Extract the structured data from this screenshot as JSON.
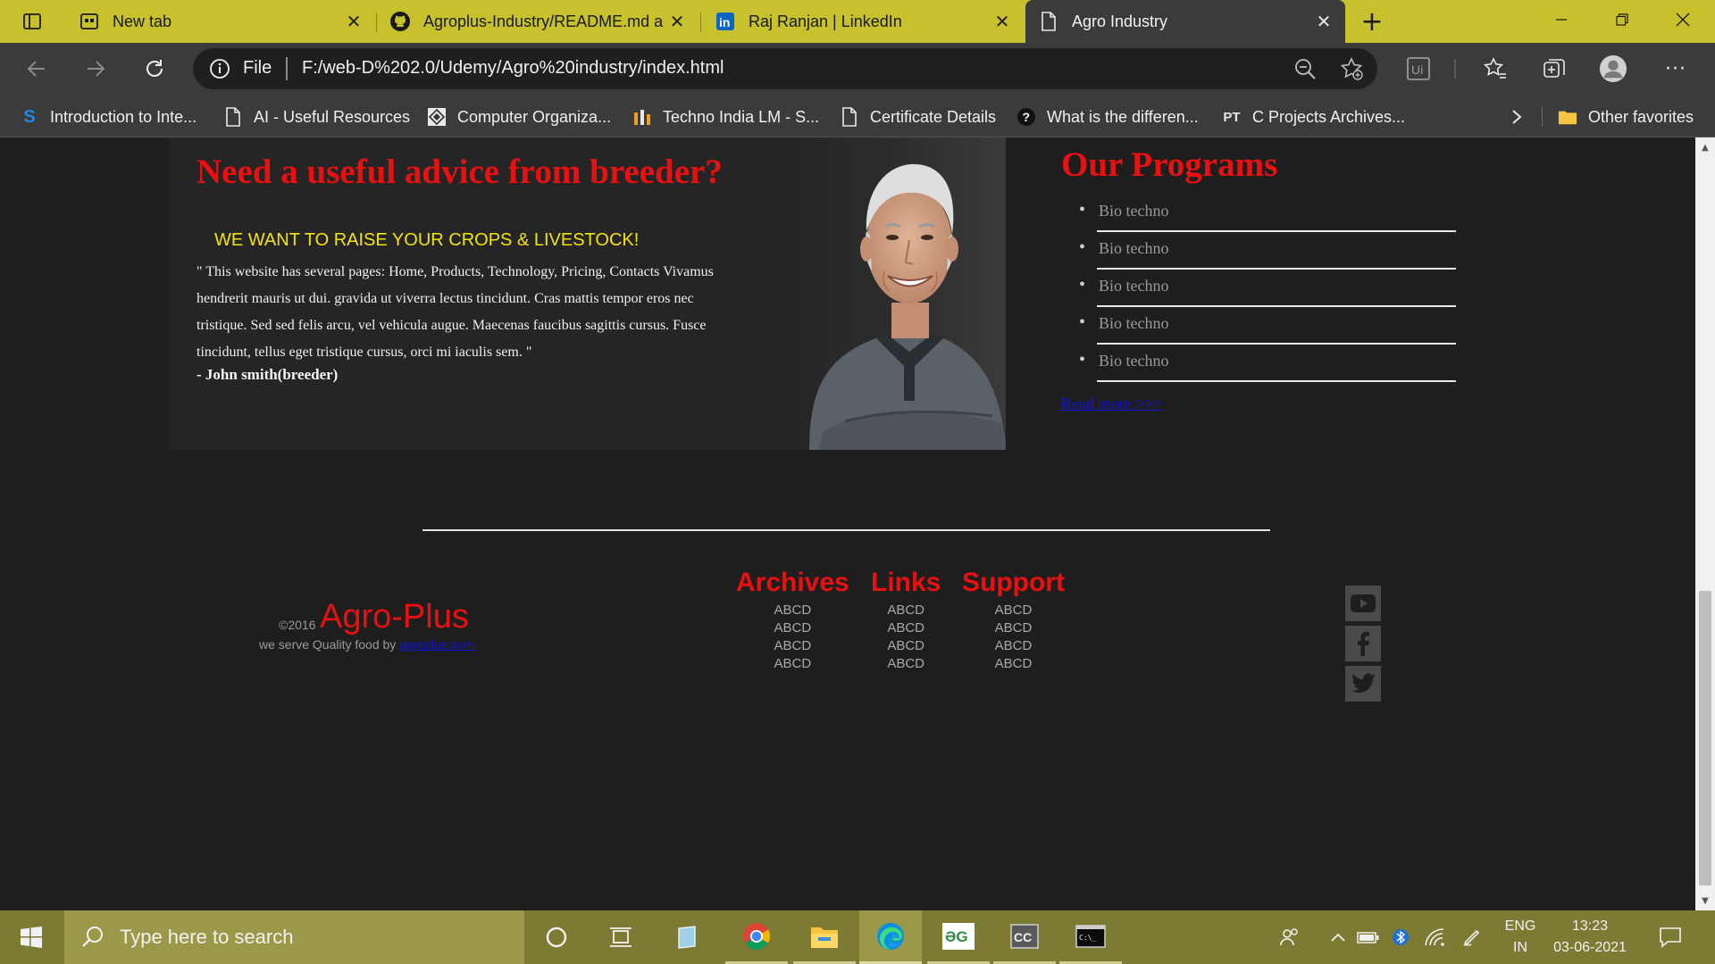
{
  "browser": {
    "tabs": [
      {
        "title": "New tab",
        "icon": "new-tab-page-icon"
      },
      {
        "title": "Agroplus-Industry/README.md a",
        "icon": "github-icon"
      },
      {
        "title": "Raj Ranjan | LinkedIn",
        "icon": "linkedin-icon"
      },
      {
        "title": "Agro Industry",
        "icon": "page-icon",
        "active": true
      }
    ],
    "address": {
      "scheme_label": "File",
      "url": "F:/web-D%202.0/Udemy/Agro%20industry/index.html"
    },
    "favorites": [
      {
        "label": "Introduction to Inte...",
        "icon": "s-logo-icon"
      },
      {
        "label": "AI - Useful Resources",
        "icon": "page-icon"
      },
      {
        "label": "Computer Organiza...",
        "icon": "diamond-logo-icon"
      },
      {
        "label": "Techno India LM - S...",
        "icon": "ti-logo-icon"
      },
      {
        "label": "Certificate Details",
        "icon": "page-icon"
      },
      {
        "label": "What is the differen...",
        "icon": "question-icon"
      },
      {
        "label": "C Projects Archives...",
        "icon": "pt-logo-icon"
      }
    ],
    "other_favorites": "Other favorites"
  },
  "page": {
    "testimonial": {
      "title": "Need a useful advice from breeder?",
      "tagline": "WE WANT TO RAISE YOUR CROPS & LIVESTOCK!",
      "quote": "\" This website has several pages: Home, Products, Technology, Pricing, Contacts Vivamus hendrerit mauris ut dui. gravida ut viverra lectus tincidunt. Cras mattis tempor eros nec tristique. Sed sed felis arcu, vel vehicula augue. Maecenas faucibus sagittis cursus. Fusce tincidunt, tellus eget tristique cursus, orci mi iaculis sem. \"",
      "author": "- John smith(breeder)"
    },
    "programs": {
      "title": "Our Programs",
      "items": [
        "Bio techno",
        "Bio techno",
        "Bio techno",
        "Bio techno",
        "Bio techno"
      ],
      "read_more": "Read more >>>"
    },
    "footer": {
      "copyright": "©2016",
      "brand": "Agro-Plus",
      "serve_text": "we serve Quality food by ",
      "serve_link": "agroplus.com",
      "columns": [
        {
          "title": "Archives",
          "items": [
            "ABCD",
            "ABCD",
            "ABCD",
            "ABCD"
          ]
        },
        {
          "title": "Links",
          "items": [
            "ABCD",
            "ABCD",
            "ABCD",
            "ABCD"
          ]
        },
        {
          "title": "Support",
          "items": [
            "ABCD",
            "ABCD",
            "ABCD",
            "ABCD"
          ]
        }
      ],
      "social": [
        "youtube-icon",
        "facebook-icon",
        "twitter-icon"
      ]
    }
  },
  "taskbar": {
    "search_placeholder": "Type here to search",
    "language": {
      "line1": "ENG",
      "line2": "IN"
    },
    "clock": {
      "time": "13:23",
      "date": "03-06-2021"
    }
  },
  "colors": {
    "accent_red": "#e81010",
    "tagline_yellow": "#f2e20e",
    "link_blue": "#1010e0",
    "tabbar": "#c7c12e",
    "taskbar": "#7d7a33"
  }
}
